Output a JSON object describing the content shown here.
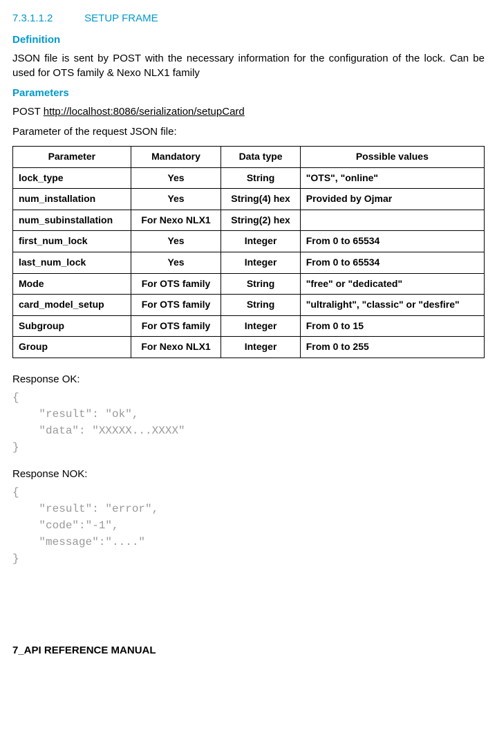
{
  "section": {
    "number": "7.3.1.1.2",
    "title": "SETUP FRAME"
  },
  "definition": {
    "heading": "Definition",
    "text": "JSON file is sent by POST with the necessary information for the configuration of the lock. Can be used for OTS family & Nexo NLX1 family"
  },
  "parameters": {
    "heading": "Parameters",
    "method": "POST ",
    "url": "http://localhost:8086/serialization/setupCard",
    "intro": "Parameter of the request JSON file:",
    "headers": [
      "Parameter",
      "Mandatory",
      "Data type",
      "Possible values"
    ],
    "rows": [
      {
        "param": "lock_type",
        "mand": "Yes",
        "dtype": "String",
        "pv": "\"OTS\", \"online\""
      },
      {
        "param": "num_installation",
        "mand": "Yes",
        "dtype": "String(4) hex",
        "pv": "Provided by Ojmar"
      },
      {
        "param": "num_subinstallation",
        "mand": "For Nexo NLX1",
        "dtype": "String(2) hex",
        "pv": ""
      },
      {
        "param": "first_num_lock",
        "mand": "Yes",
        "dtype": "Integer",
        "pv": "From 0 to 65534"
      },
      {
        "param": "last_num_lock",
        "mand": "Yes",
        "dtype": "Integer",
        "pv": "From 0 to 65534"
      },
      {
        "param": "Mode",
        "mand": "For OTS family",
        "dtype": "String",
        "pv": "\"free\" or \"dedicated\""
      },
      {
        "param": "card_model_setup",
        "mand": "For OTS family",
        "dtype": "String",
        "pv": "\"ultralight\", \"classic\" or \"desfire\""
      },
      {
        "param": "Subgroup",
        "mand": "For OTS family",
        "dtype": "Integer",
        "pv": "From 0 to 15"
      },
      {
        "param": "Group",
        "mand": "For Nexo NLX1",
        "dtype": "Integer",
        "pv": "From 0 to 255"
      }
    ]
  },
  "responses": {
    "ok_label": "Response OK:",
    "ok_code": "{\n    \"result\": \"ok\",\n    \"data\": \"XXXXX...XXXX\"\n}",
    "nok_label": "Response NOK:",
    "nok_code": "{\n    \"result\": \"error\",\n    \"code\":\"-1\",\n    \"message\":\"....\"\n}"
  },
  "footer": "7_API REFERENCE MANUAL"
}
